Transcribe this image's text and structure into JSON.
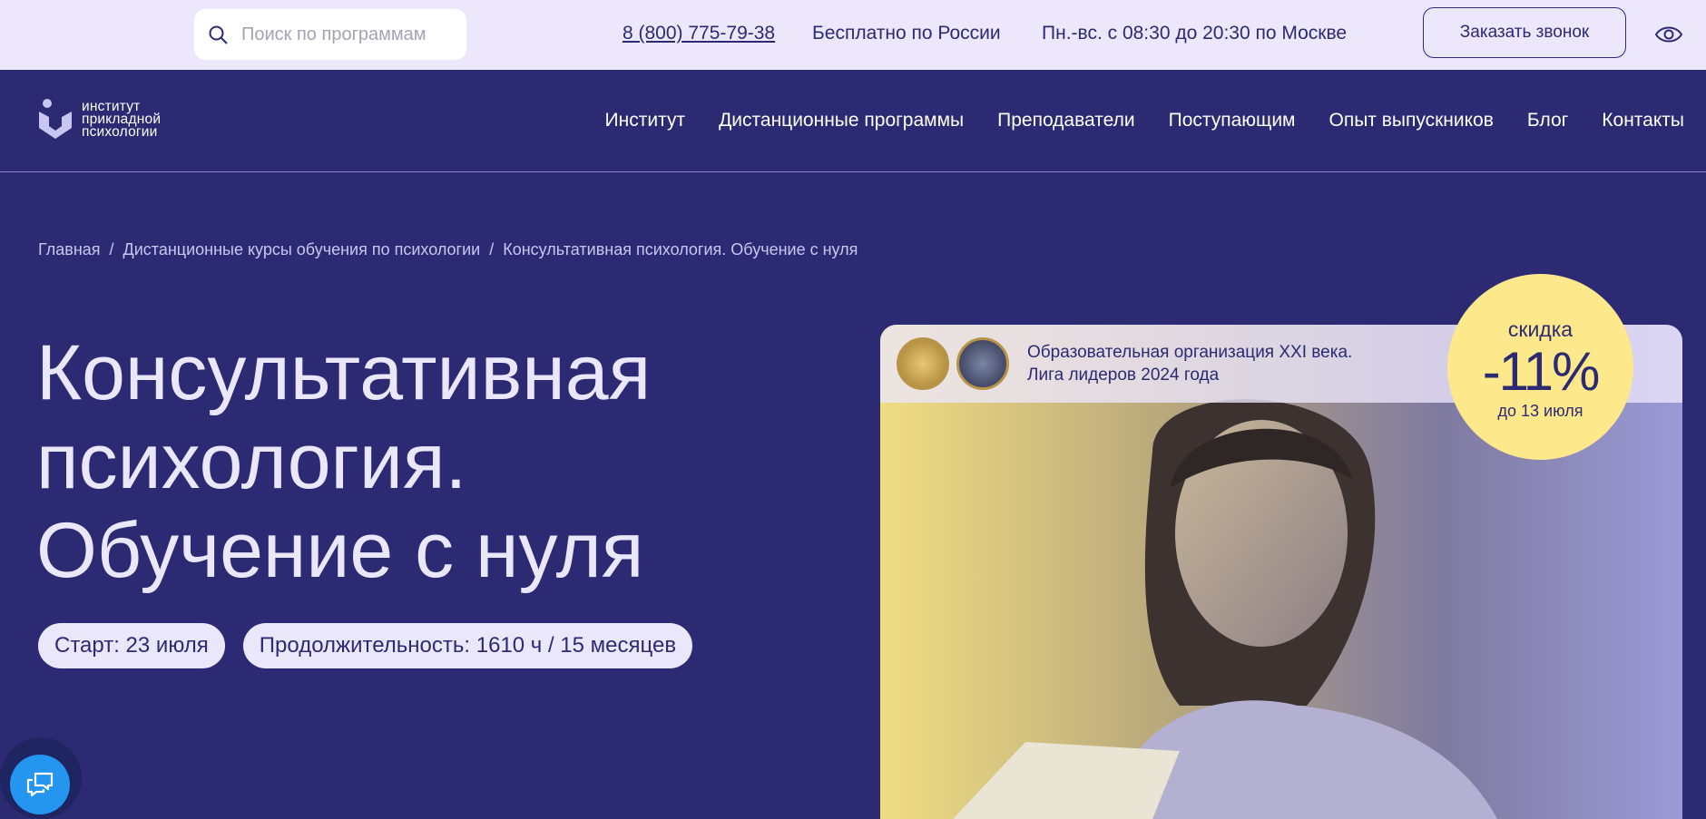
{
  "topbar": {
    "search_placeholder": "Поиск по программам",
    "phone": "8 (800) 775-79-38",
    "free_label": "Бесплатно по России",
    "hours": "Пн.-вс. с 08:30 до 20:30 по Москве",
    "callback_label": "Заказать звонок"
  },
  "logo": {
    "line1": "институт",
    "line2": "прикладной",
    "line3": "психологии"
  },
  "nav": [
    {
      "label": "Институт"
    },
    {
      "label": "Дистанционные программы"
    },
    {
      "label": "Преподаватели"
    },
    {
      "label": "Поступающим"
    },
    {
      "label": "Опыт выпускников"
    },
    {
      "label": "Блог"
    },
    {
      "label": "Контакты"
    }
  ],
  "breadcrumb": {
    "home": "Главная",
    "section": "Дистанционные курсы обучения по психологии",
    "current": "Консультативная психология. Обучение с нуля",
    "sep": "/"
  },
  "hero": {
    "title_line1": "Консультативная",
    "title_line2": "психология.",
    "title_line3": "Обучение с нуля",
    "start": "Старт: 23 июля",
    "duration": "Продолжительность: 1610 ч / 15 месяцев"
  },
  "award": {
    "line1": "Образовательная организация XXI века.",
    "line2": "Лига лидеров 2024 года"
  },
  "discount": {
    "label": "скидка",
    "percent": "-11%",
    "until": "до 13 июля"
  },
  "colors": {
    "primary": "#2b2a73",
    "topbar_bg": "#ece7fb",
    "badge": "#fde88c",
    "chat": "#2496f0"
  }
}
